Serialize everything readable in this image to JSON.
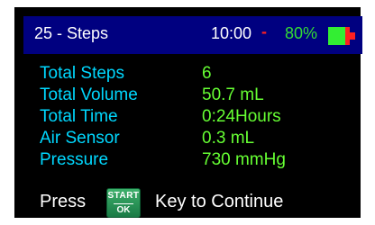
{
  "status_bar": {
    "title": "25 - Steps",
    "time": "10:00",
    "separator": "-",
    "battery_percent": "80%",
    "battery_level": 0.8,
    "colors": {
      "bar_background": "#000080",
      "separator": "#ff2020",
      "battery_percent_text": "#33dd33",
      "battery_fill": "#33ee33",
      "battery_empty": "#ff2020"
    }
  },
  "summary": {
    "rows": [
      {
        "label": "Total Steps",
        "value": "6"
      },
      {
        "label": "Total Volume",
        "value": "50.7 mL"
      },
      {
        "label": "Total Time",
        "value": "0:24Hours"
      },
      {
        "label": "Air Sensor",
        "value": "0.3 mL"
      },
      {
        "label": "Pressure",
        "value": "730 mmHg"
      }
    ],
    "colors": {
      "label": "#00d8ff",
      "value": "#66ff33"
    }
  },
  "footer": {
    "press_text": "Press",
    "button": {
      "top_label": "START",
      "bottom_label": "OK",
      "icon": "start-ok-key-icon"
    },
    "continue_text": "Key to Continue"
  }
}
